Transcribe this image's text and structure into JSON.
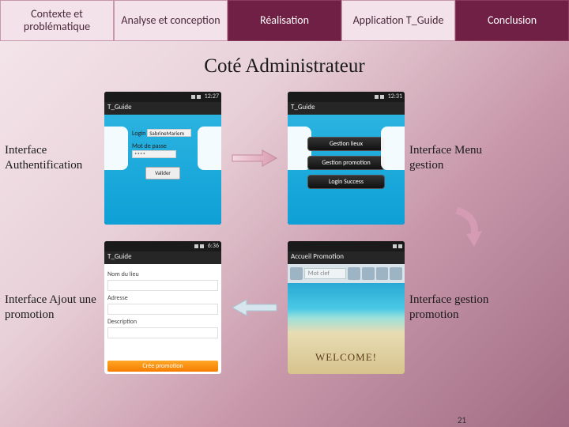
{
  "tabs": [
    "Contexte et problématique",
    "Analyse et conception",
    "Réalisation",
    "Application T_Guide",
    "Conclusion"
  ],
  "title": "Coté Administrateur",
  "labels": {
    "auth": "Interface Authentification",
    "menu": "Interface Menu gestion",
    "ajout": "Interface Ajout une promotion",
    "gestpromo": "Interface gestion promotion"
  },
  "phone1": {
    "time": "12:27",
    "hdr": "T_Guide",
    "login_lbl": "Login",
    "login_val": "SabrineMariem",
    "pass_lbl": "Mot de passe",
    "pass_val": "****",
    "btn": "Valider"
  },
  "phone2": {
    "time": "12:31",
    "hdr": "T_Guide",
    "b1": "Gestion lieux",
    "b2": "Gestion promotion",
    "b3": "Login Success"
  },
  "phone3": {
    "time": "6:36",
    "hdr": "T_Guide",
    "f1": "Nom du lieu",
    "f2": "Adresse",
    "f3": "Description",
    "btn": "Crée promotion"
  },
  "phone4": {
    "hdr": "Accueil Promotion",
    "search": "Mot clef",
    "welcome": "WELCOME!"
  },
  "page": "21"
}
